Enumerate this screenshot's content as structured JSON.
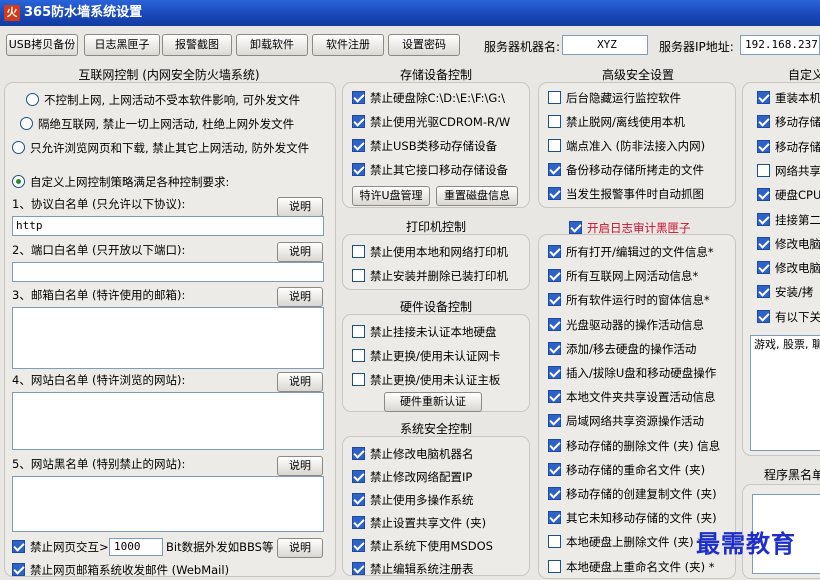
{
  "window": {
    "title": "365防水墙系统设置",
    "icon": "app-shield-icon"
  },
  "toolbar": [
    "USB拷贝备份",
    "日志黑匣子",
    "报警截图",
    "卸载软件",
    "软件注册",
    "设置密码"
  ],
  "server": {
    "name_label": "服务器机器名:",
    "name_value": "XYZ",
    "ip_label": "服务器IP地址:",
    "ip_value": "192.168.237."
  },
  "internet": {
    "title": "互联网控制 (内网安全防火墙系统)",
    "radios": [
      "不控制上网, 上网活动不受本软件影响, 可外发文件",
      "隔绝互联网, 禁止一切上网活动, 杜绝上网外发文件",
      "只允许浏览网页和下载, 禁止其它上网活动, 防外发文件"
    ],
    "custom_radio": "自定义上网控制策略满足各种控制要求:",
    "explain_label": "说明",
    "protocol_label": "1、协议白名单 (只允许以下协议):",
    "protocol_value": "http",
    "port_label": "2、端口白名单 (只开放以下端口):",
    "mail_label": "3、邮箱白名单 (特许使用的邮箱):",
    "site_white_label": "4、网站白名单 (特许浏览的网站):",
    "site_black_label": "5、网站黑名单 (特别禁止的网站):",
    "interact_prefix": "禁止网页交互>",
    "interact_value": "1000",
    "interact_suffix": "Bit数据外发如BBS等",
    "cut_row": "禁止网页邮箱系统收发邮件 (WebMail)"
  },
  "storage": {
    "title": "存储设备控制",
    "items": [
      "禁止硬盘除C:\\D:\\E:\\F:\\G:\\",
      "禁止使用光驱CDROM-R/W",
      "禁止USB类移动存储设备",
      "禁止其它接口移动存储设备"
    ],
    "btn_special": "特许U盘管理",
    "btn_reset": "重置磁盘信息"
  },
  "printer": {
    "title": "打印机控制",
    "items": [
      "禁止使用本地和网络打印机",
      "禁止安装并删除已装打印机"
    ]
  },
  "hardware": {
    "title": "硬件设备控制",
    "items": [
      "禁止挂接未认证本地硬盘",
      "禁止更换/使用未认证网卡",
      "禁止更换/使用未认证主板"
    ],
    "btn_reauth": "硬件重新认证"
  },
  "system": {
    "title": "系统安全控制",
    "items": [
      "禁止修改电脑机器名",
      "禁止修改网络配置IP",
      "禁止使用多操作系统",
      "禁止设置共享文件 (夹)",
      "禁止系统下使用MSDOS",
      "禁止编辑系统注册表"
    ]
  },
  "advanced": {
    "title": "高级安全设置",
    "items": [
      "后台隐藏运行监控软件",
      "禁止脱网/离线使用本机",
      "端点准入 (防非法接入内网)",
      "备份移动存储所拷走的文件",
      "当发生报警事件时自动抓图"
    ],
    "checked": [
      false,
      false,
      false,
      true,
      true
    ]
  },
  "audit": {
    "header": "开启日志审计黑匣子",
    "items": [
      "所有打开/编辑过的文件信息*",
      "所有互联网上网活动信息*",
      "所有软件运行时的窗体信息*",
      "光盘驱动器的操作活动信息",
      "添加/移去硬盘的操作活动",
      "插入/拔除U盘和移动硬盘操作",
      "本地文件夹共享设置活动信息",
      "局域网络共享资源操作活动",
      "移动存储的删除文件 (夹) 信息",
      "移动存储的重命名文件 (夹)",
      "移动存储的创建复制文件 (夹)",
      "其它未知移动存储的文件 (夹)",
      "本地硬盘上删除文件 (夹) *",
      "本地硬盘上重命名文件 (夹) *"
    ],
    "checked": [
      true,
      true,
      true,
      true,
      true,
      true,
      true,
      true,
      true,
      true,
      true,
      true,
      false,
      false
    ]
  },
  "custom": {
    "title": "自定义",
    "items": [
      "重装本机",
      "移动存储",
      "移动存储",
      "网络共享",
      "硬盘CPU",
      "挂接第二",
      "修改电脑",
      "修改电脑",
      "安装/拷",
      "有以下关"
    ],
    "checked": [
      true,
      true,
      true,
      false,
      true,
      true,
      true,
      true,
      true,
      true
    ],
    "keywords": "游戏, 股票, 聊",
    "program_blacklist": "程序黑名单"
  },
  "watermark": "最需教育"
}
